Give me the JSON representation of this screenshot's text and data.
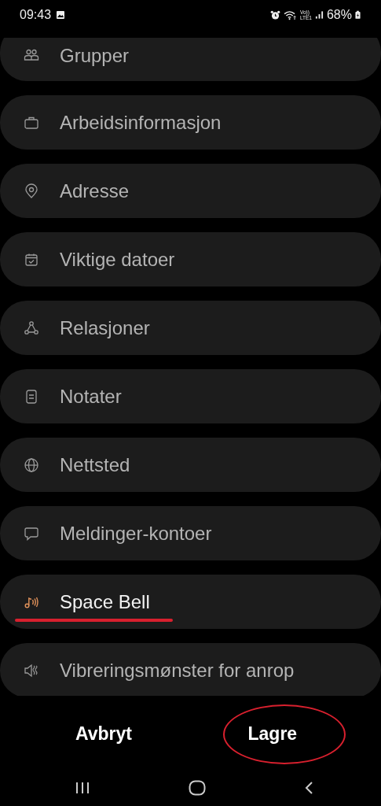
{
  "status_bar": {
    "time": "09:43",
    "volte_top": "Vo))",
    "volte_bottom": "LTE1",
    "battery": "68%"
  },
  "fields": [
    {
      "label": "Grupper",
      "set": false,
      "highlighted": false
    },
    {
      "label": "Arbeidsinformasjon",
      "set": false,
      "highlighted": false
    },
    {
      "label": "Adresse",
      "set": false,
      "highlighted": false
    },
    {
      "label": "Viktige datoer",
      "set": false,
      "highlighted": false
    },
    {
      "label": "Relasjoner",
      "set": false,
      "highlighted": false
    },
    {
      "label": "Notater",
      "set": false,
      "highlighted": false
    },
    {
      "label": "Nettsted",
      "set": false,
      "highlighted": false
    },
    {
      "label": "Meldinger-kontoer",
      "set": false,
      "highlighted": false
    },
    {
      "label": "Space Bell",
      "set": true,
      "highlighted": true
    },
    {
      "label": "Vibreringsmønster for anrop",
      "set": false,
      "highlighted": false
    }
  ],
  "actions": [
    {
      "label": "Avbryt",
      "highlighted": false
    },
    {
      "label": "Lagre",
      "highlighted": true
    }
  ]
}
